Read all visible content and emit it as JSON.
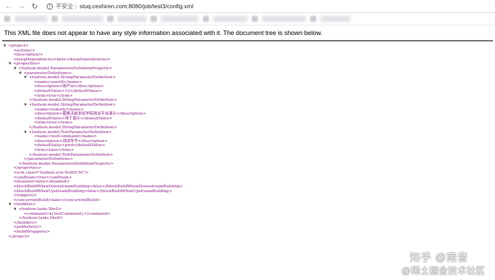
{
  "browser": {
    "insecure_label": "不安全",
    "separator": "|",
    "url": "stuq.ceshiren.com:8080/job/test3/config.xml",
    "back_icon": "arrow-left-icon",
    "forward_icon": "arrow-right-icon",
    "reload_icon": "reload-icon",
    "info_icon": "info-icon"
  },
  "viewer": {
    "notice": "This XML file does not appear to have any style information associated with it. The document tree is shown below."
  },
  "xml_lines": [
    {
      "t": "▼",
      "x": 0,
      "text": "<project>"
    },
    {
      "t": "",
      "x": 1,
      "text": "<actions/>"
    },
    {
      "t": "",
      "x": 1,
      "text": "<description/>"
    },
    {
      "t": "",
      "x": 1,
      "text": "<keepDependencies>false</keepDependencies>"
    },
    {
      "t": "▼",
      "x": 1,
      "text": "<properties>"
    },
    {
      "t": "▼",
      "x": 2,
      "text": "<hudson.model.ParametersDefinitionProperty>"
    },
    {
      "t": "▼",
      "x": 3,
      "text": "<parameterDefinitions>"
    },
    {
      "t": "▼",
      "x": 4,
      "text": "<hudson.model.StringParameterDefinition>"
    },
    {
      "t": "",
      "x": 5,
      "text": "<name>userId</name>"
    },
    {
      "t": "",
      "x": 5,
      "text": "<description>用户Id</description>"
    },
    {
      "t": "",
      "x": 5,
      "text": "<defaultValue>12</defaultValue>"
    },
    {
      "t": "",
      "x": 5,
      "text": "<trim>true</trim>"
    },
    {
      "t": "",
      "x": 4,
      "text": "</hudson.model.StringParameterDefinition>"
    },
    {
      "t": "▼",
      "x": 4,
      "text": "<hudson.model.StringParameterDefinition>"
    },
    {
      "t": "",
      "x": 5,
      "text": "<name>remark</name>"
    },
    {
      "t": "",
      "x": 5,
      "text": "<description>霍格沃兹测试学院测试平台演示</description>"
    },
    {
      "t": "",
      "x": 5,
      "text": "<defaultValue>用于演示</defaultValue>"
    },
    {
      "t": "",
      "x": 5,
      "text": "<trim>true</trim>"
    },
    {
      "t": "",
      "x": 4,
      "text": "</hudson.model.StringParameterDefinition>"
    },
    {
      "t": "▼",
      "x": 4,
      "text": "<hudson.model.TextParameterDefinition>"
    },
    {
      "t": "",
      "x": 5,
      "text": "<name>testCommand</name>"
    },
    {
      "t": "",
      "x": 5,
      "text": "<description>测试命令</description>"
    },
    {
      "t": "",
      "x": 5,
      "text": "<defaultValue>pwd</defaultValue>"
    },
    {
      "t": "",
      "x": 5,
      "text": "<trim>false</trim>"
    },
    {
      "t": "",
      "x": 4,
      "text": "</hudson.model.TextParameterDefinition>"
    },
    {
      "t": "",
      "x": 3,
      "text": "</parameterDefinitions>"
    },
    {
      "t": "",
      "x": 2,
      "text": "</hudson.model.ParametersDefinitionProperty>"
    },
    {
      "t": "",
      "x": 1,
      "text": "</properties>"
    },
    {
      "t": "",
      "x": 1,
      "text": "<scm class=\"hudson.scm.NullSCM\"/>"
    },
    {
      "t": "",
      "x": 1,
      "text": "<canRoam>true</canRoam>"
    },
    {
      "t": "",
      "x": 1,
      "text": "<disabled>false</disabled>"
    },
    {
      "t": "",
      "x": 1,
      "text": "<blockBuildWhenDownstreamBuilding>false</blockBuildWhenDownstreamBuilding>"
    },
    {
      "t": "",
      "x": 1,
      "text": "<blockBuildWhenUpstreamBuilding>false</blockBuildWhenUpstreamBuilding>"
    },
    {
      "t": "",
      "x": 1,
      "text": "<triggers/>"
    },
    {
      "t": "",
      "x": 1,
      "text": "<concurrentBuild>false</concurrentBuild>"
    },
    {
      "t": "▼",
      "x": 1,
      "text": "<builders>"
    },
    {
      "t": "▼",
      "x": 2,
      "text": "<hudson.tasks.Shell>"
    },
    {
      "t": "",
      "x": 3,
      "text": "<command>${testCommand}</command>"
    },
    {
      "t": "",
      "x": 2,
      "text": "</hudson.tasks.Shell>"
    },
    {
      "t": "",
      "x": 1,
      "text": "</builders>"
    },
    {
      "t": "",
      "x": 1,
      "text": "<publishers/>"
    },
    {
      "t": "",
      "x": 1,
      "text": "<buildWrappers/>"
    },
    {
      "t": "",
      "x": 0,
      "text": "</project>"
    }
  ],
  "watermark": {
    "line1": "知乎 @南音",
    "line2": "@稀土掘金技术社区"
  }
}
